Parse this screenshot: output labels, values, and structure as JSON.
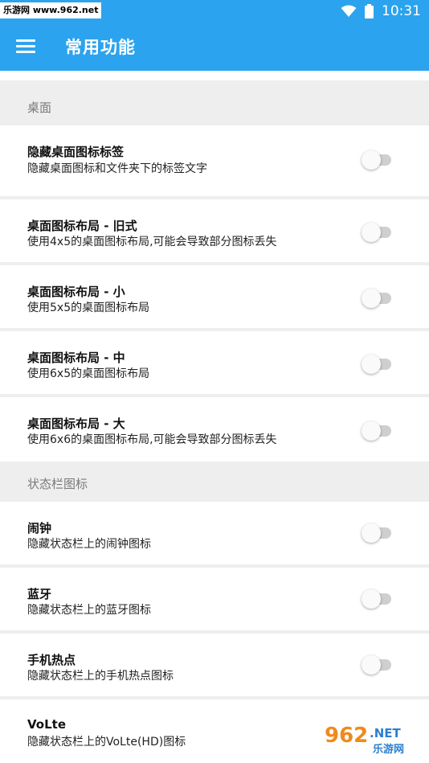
{
  "status_bar": {
    "watermark": "乐游网 www.962.net",
    "time": "10:31",
    "wifi_icon": "wifi-icon",
    "battery_icon": "battery-icon"
  },
  "app_bar": {
    "menu_icon": "menu-icon",
    "title": "常用功能",
    "color": "#2ba3ee"
  },
  "sections": [
    {
      "header": "桌面",
      "items": [
        {
          "title": "隐藏桌面图标标签",
          "desc": "隐藏桌面图标和文件夹下的标签文字",
          "enabled": false
        },
        {
          "title": "桌面图标布局 - 旧式",
          "desc": "使用4x5的桌面图标布局,可能会导致部分图标丢失",
          "enabled": false
        },
        {
          "title": "桌面图标布局 - 小",
          "desc": "使用5x5的桌面图标布局",
          "enabled": false
        },
        {
          "title": "桌面图标布局 - 中",
          "desc": "使用6x5的桌面图标布局",
          "enabled": false
        },
        {
          "title": "桌面图标布局 - 大",
          "desc": "使用6x6的桌面图标布局,可能会导致部分图标丢失",
          "enabled": false
        }
      ]
    },
    {
      "header": "状态栏图标",
      "items": [
        {
          "title": "闹钟",
          "desc": "隐藏状态栏上的闹钟图标",
          "enabled": false
        },
        {
          "title": "蓝牙",
          "desc": "隐藏状态栏上的蓝牙图标",
          "enabled": false
        },
        {
          "title": "手机热点",
          "desc": "隐藏状态栏上的手机热点图标",
          "enabled": false
        },
        {
          "title": "VoLte",
          "desc": "隐藏状态栏上的VoLte(HD)图标",
          "enabled": false
        }
      ]
    }
  ],
  "bottom_watermark": {
    "number": "962",
    "suffix": ".NET",
    "name": "乐游网"
  }
}
